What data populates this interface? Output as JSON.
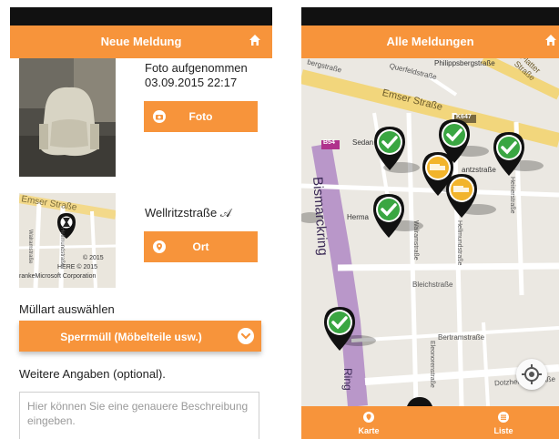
{
  "left": {
    "title": "Neue Meldung",
    "photo_status_line1": "Foto aufgenommen",
    "photo_status_line2": "03.09.2015 22:17",
    "photo_button": "Foto",
    "address": "Wellritzstraße 𝒜",
    "location_button": "Ort",
    "minimap": {
      "street": "Emser Straße",
      "street2": "Walramstraße",
      "street3": "Hellmundstraße",
      "copyright1": "© 2015",
      "copyright2": "HERE   © 2015",
      "copyright3": "rankeMicrosoft Corporation"
    },
    "category_label": "Müllart auswählen",
    "category_value": "Sperrmüll (Möbelteile usw.)",
    "details_label": "Weitere Angaben (optional).",
    "details_placeholder": "Hier können Sie eine genauere Beschreibung eingeben."
  },
  "right": {
    "title": "Alle Meldungen",
    "streets": {
      "philippsberg": "Philippsbergstraße",
      "platter": "Platter Straße",
      "emser": "Emser Straße",
      "bergstr": "bergstraße",
      "querfeld": "Querfeldstraße",
      "k647": "K647",
      "b54": "B54",
      "sedan": "Sedan",
      "bismarck": "Bismarckring",
      "herma": "Herma",
      "antzstr": "antzstraße",
      "walram": "Walramstraße",
      "hellmund": "Hellmundstraße",
      "bleich": "Bleichstraße",
      "bertram": "Bertramstraße",
      "eleonoren": "Eleonorenstraße",
      "dotzheim": "Dotzheimer Straße",
      "ring": "Ring",
      "heiner": "Heinerstraße"
    },
    "tabs": [
      {
        "label": "Karte",
        "icon": "map-pin-icon"
      },
      {
        "label": "Liste",
        "icon": "list-icon"
      }
    ],
    "colors": {
      "accent": "#f7943b",
      "pin_check": "#3aa642",
      "pin_truck": "#f2b42b"
    }
  }
}
